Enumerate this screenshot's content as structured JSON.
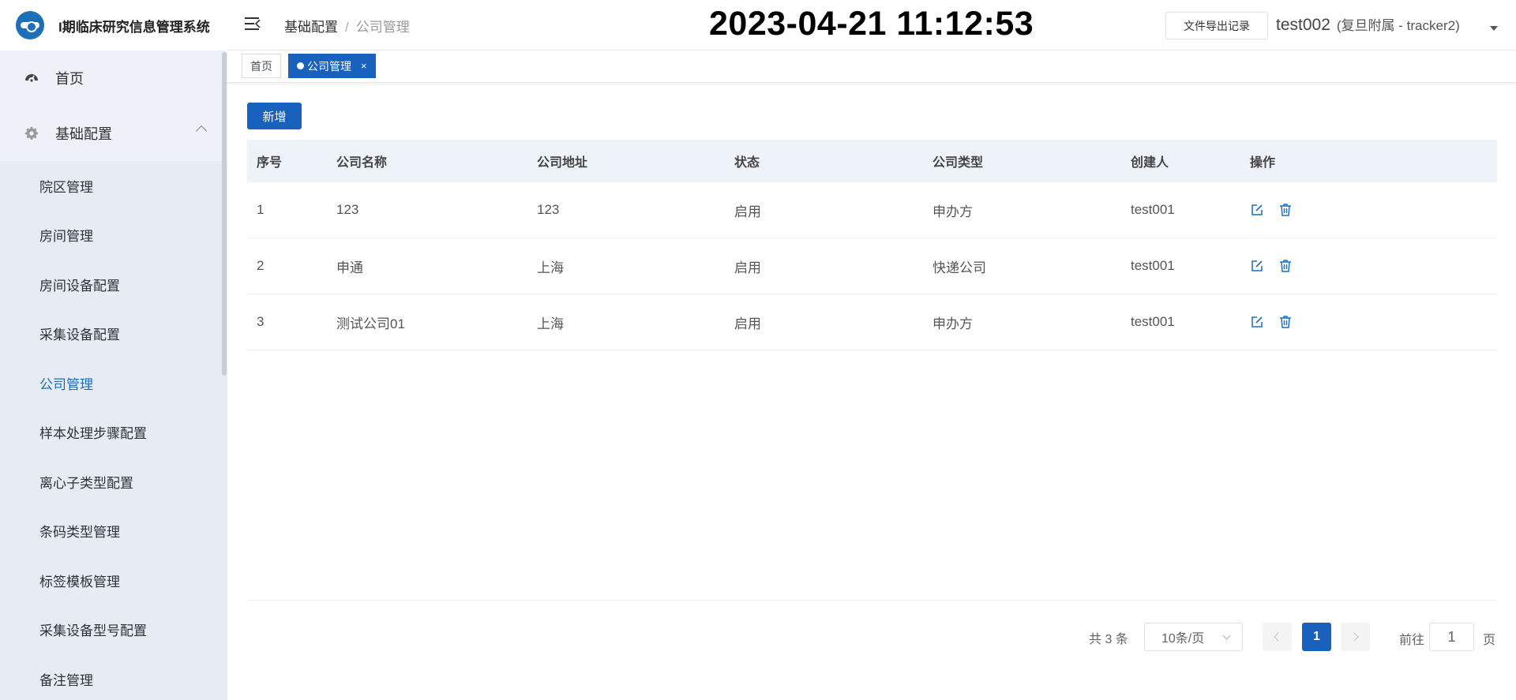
{
  "app": {
    "title": "I期临床研究信息管理系统"
  },
  "sidebar": {
    "home": "首页",
    "group": "基础配置",
    "items": [
      {
        "label": "院区管理"
      },
      {
        "label": "房间管理"
      },
      {
        "label": "房间设备配置"
      },
      {
        "label": "采集设备配置"
      },
      {
        "label": "公司管理",
        "active": true
      },
      {
        "label": "样本处理步骤配置"
      },
      {
        "label": "离心子类型配置"
      },
      {
        "label": "条码类型管理"
      },
      {
        "label": "标签模板管理"
      },
      {
        "label": "采集设备型号配置"
      },
      {
        "label": "备注管理"
      }
    ]
  },
  "header": {
    "breadcrumb": [
      "基础配置",
      "公司管理"
    ],
    "separator": "/",
    "clock": "2023-04-21 11:12:53",
    "export_label": "文件导出记录",
    "user": "test002",
    "affiliation": "(复旦附属 - tracker2)"
  },
  "tabs": [
    {
      "label": "首页"
    },
    {
      "label": "公司管理",
      "close": "×"
    }
  ],
  "toolbar": {
    "add_label": "新增"
  },
  "table": {
    "columns": [
      "序号",
      "公司名称",
      "公司地址",
      "状态",
      "公司类型",
      "创建人",
      "操作"
    ],
    "rows": [
      [
        "1",
        "123",
        "123",
        "启用",
        "申办方",
        "test001"
      ],
      [
        "2",
        "申通",
        "上海",
        "启用",
        "快递公司",
        "test001"
      ],
      [
        "3",
        "测试公司01",
        "上海",
        "启用",
        "申办方",
        "test001"
      ]
    ]
  },
  "pagination": {
    "total": "共 3 条",
    "page_size": "10条/页",
    "current": "1",
    "goto_label": "前往",
    "goto_value": "1",
    "page_suffix": "页"
  },
  "colors": {
    "primary": "#1861bd",
    "sidebar_bg": "#eef1f8",
    "active_text": "#1a6fc4"
  },
  "icons": {
    "home": "dashboard-icon",
    "group": "gear-icon",
    "edit": "edit-icon",
    "delete": "trash-icon"
  }
}
